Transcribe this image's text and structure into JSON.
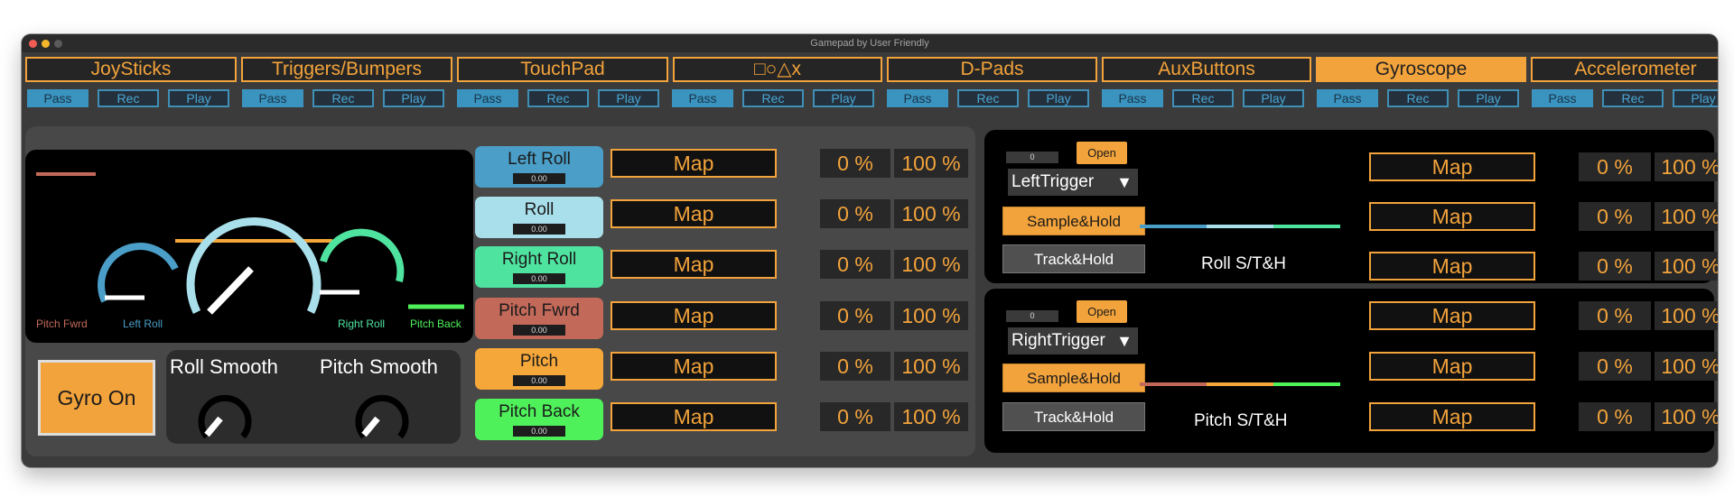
{
  "window": {
    "title": "Gamepad by User Friendly"
  },
  "tabs": [
    {
      "label": "JoySticks",
      "active": false
    },
    {
      "label": "Triggers/Bumpers",
      "active": false
    },
    {
      "label": "TouchPad",
      "active": false
    },
    {
      "label": "□○△x",
      "active": false
    },
    {
      "label": "D-Pads",
      "active": false
    },
    {
      "label": "AuxButtons",
      "active": false
    },
    {
      "label": "Gyroscope",
      "active": true
    },
    {
      "label": "Accelerometer",
      "active": false
    }
  ],
  "tab_buttons": {
    "pass": "Pass",
    "rec": "Rec",
    "play": "Play"
  },
  "gyro_display": {
    "labels": {
      "pitch_fwrd": "Pitch Fwrd",
      "left_roll": "Left Roll",
      "right_roll": "Right Roll",
      "pitch_back": "Pitch Back"
    }
  },
  "gyro_on_label": "Gyro On",
  "knobs": {
    "roll_smooth": "Roll Smooth",
    "pitch_smooth": "Pitch Smooth"
  },
  "channels": [
    {
      "label": "Left Roll",
      "value": "0.00",
      "color": "#4a9ec7"
    },
    {
      "label": "Roll",
      "value": "0.00",
      "color": "#a9dfeb"
    },
    {
      "label": "Right Roll",
      "value": "0.00",
      "color": "#4fe3a0"
    },
    {
      "label": "Pitch Fwrd",
      "value": "0.00",
      "color": "#c2695a"
    },
    {
      "label": "Pitch",
      "value": "0.00",
      "color": "#f5a73a"
    },
    {
      "label": "Pitch Back",
      "value": "0.00",
      "color": "#4ff15b"
    }
  ],
  "map_label": "Map",
  "range": {
    "min": "0 %",
    "max": "100 %"
  },
  "roll_panel": {
    "num": "0",
    "open": "Open",
    "trigger": "LeftTrigger",
    "sample_hold": "Sample&Hold",
    "track_hold": "Track&Hold",
    "title": "Roll S/T&H",
    "rows": 3
  },
  "pitch_panel": {
    "num": "0",
    "open": "Open",
    "trigger": "RightTrigger",
    "sample_hold": "Sample&Hold",
    "track_hold": "Track&Hold",
    "title": "Pitch S/T&H",
    "rows": 3
  },
  "dropdown_arrow": "▼",
  "colors": {
    "accent": "#f3a33b",
    "button_blue": "#3a94bf",
    "background": "#3b3b3b"
  }
}
